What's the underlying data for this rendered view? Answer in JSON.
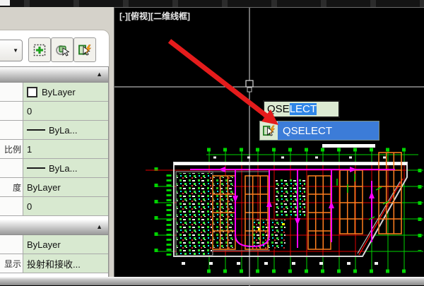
{
  "viewport": {
    "label": "[-][俯视][二维线框]"
  },
  "command_input": {
    "typed": "QSE",
    "autocompleted_selected": "LECT",
    "full_command": "QSELECT"
  },
  "autocomplete": {
    "items": [
      {
        "label": "QSELECT",
        "icon": "quick-select-icon",
        "highlighted": true
      }
    ]
  },
  "properties_panel": {
    "toolbar": {
      "combo_arrow": "▼",
      "buttons": [
        {
          "icon": "select-objects-icon"
        },
        {
          "icon": "quick-select-cursor-icon"
        },
        {
          "icon": "quick-select-lightning-icon"
        }
      ]
    },
    "collapse_icon": "▲",
    "sections": [
      {
        "rows": [
          {
            "label": "",
            "value": "ByLayer",
            "swatch": "color"
          },
          {
            "label": "",
            "value": "0",
            "swatch": "none"
          },
          {
            "label": "",
            "value": "ByLa...",
            "swatch": "line"
          },
          {
            "label": "比例",
            "value": "1",
            "swatch": "none"
          },
          {
            "label": "",
            "value": "ByLa...",
            "swatch": "line"
          },
          {
            "label": "度",
            "value": "ByLayer",
            "swatch": "none"
          },
          {
            "label": "",
            "value": "0",
            "swatch": "none"
          }
        ]
      },
      {
        "rows": [
          {
            "label": "",
            "value": "ByLayer",
            "swatch": "none"
          },
          {
            "label": "显示",
            "value": "投射和接收...",
            "swatch": "none"
          }
        ]
      }
    ]
  },
  "colors": {
    "selection_blue": "#2f86e8",
    "autocomplete_highlight": "#3c7cd8",
    "command_input_bg": "#dcead2",
    "value_cell_green": "#d8e9d0",
    "cad_green": "#00d400",
    "cad_red": "#e00000",
    "cad_orange": "#ff7f1e",
    "cad_magenta": "#ff00ff",
    "annotation_arrow_red": "#e51c1c"
  }
}
